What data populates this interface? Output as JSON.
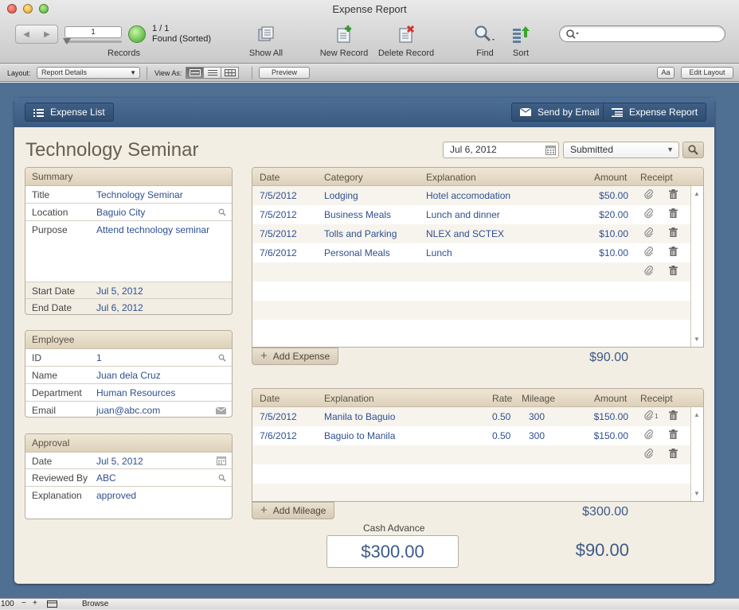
{
  "window": {
    "title": "Expense Report"
  },
  "toolbar": {
    "record_input": "1",
    "found_count": "1 / 1",
    "found_text": "Found (Sorted)",
    "records_label": "Records",
    "show_all": "Show All",
    "new_record": "New Record",
    "delete_record": "Delete Record",
    "find": "Find",
    "sort": "Sort",
    "search_placeholder": ""
  },
  "layout_bar": {
    "layout_label": "Layout:",
    "layout_value": "Report Details",
    "view_as_label": "View As:",
    "preview": "Preview",
    "aa_button": "Aa",
    "edit_layout": "Edit Layout"
  },
  "header": {
    "expense_list": "Expense List",
    "send_by_email": "Send by Email",
    "expense_report": "Expense Report"
  },
  "report": {
    "title": "Technology Seminar",
    "date": "Jul 6, 2012",
    "status": "Submitted"
  },
  "summary": {
    "heading": "Summary",
    "fields": {
      "title_label": "Title",
      "title_value": "Technology Seminar",
      "location_label": "Location",
      "location_value": "Baguio City",
      "purpose_label": "Purpose",
      "purpose_value": "Attend technology seminar",
      "start_label": "Start Date",
      "start_value": "Jul 5, 2012",
      "end_label": "End Date",
      "end_value": "Jul 6, 2012"
    }
  },
  "employee": {
    "heading": "Employee",
    "id_label": "ID",
    "id_value": "1",
    "name_label": "Name",
    "name_value": "Juan dela Cruz",
    "dept_label": "Department",
    "dept_value": "Human Resources",
    "email_label": "Email",
    "email_value": "juan@abc.com"
  },
  "approval": {
    "heading": "Approval",
    "date_label": "Date",
    "date_value": "Jul 5, 2012",
    "reviewed_label": "Reviewed By",
    "reviewed_value": "ABC",
    "explanation_label": "Explanation",
    "explanation_value": "approved"
  },
  "expenses": {
    "columns": {
      "date": "Date",
      "category": "Category",
      "explanation": "Explanation",
      "amount": "Amount",
      "receipt": "Receipt"
    },
    "rows": [
      {
        "date": "7/5/2012",
        "category": "Lodging",
        "explanation": "Hotel accomodation",
        "amount": "$50.00"
      },
      {
        "date": "7/5/2012",
        "category": "Business Meals",
        "explanation": "Lunch and dinner",
        "amount": "$20.00"
      },
      {
        "date": "7/5/2012",
        "category": "Tolls and Parking",
        "explanation": "NLEX and SCTEX",
        "amount": "$10.00"
      },
      {
        "date": "7/6/2012",
        "category": "Personal Meals",
        "explanation": "Lunch",
        "amount": "$10.00"
      }
    ],
    "add_label": "Add Expense",
    "total": "$90.00"
  },
  "mileage": {
    "columns": {
      "date": "Date",
      "explanation": "Explanation",
      "rate": "Rate",
      "mileage": "Mileage",
      "amount": "Amount",
      "receipt": "Receipt"
    },
    "rows": [
      {
        "date": "7/5/2012",
        "explanation": "Manila to Baguio",
        "rate": "0.50",
        "mileage": "300",
        "amount": "$150.00",
        "receipt_count": "1"
      },
      {
        "date": "7/6/2012",
        "explanation": "Baguio to Manila",
        "rate": "0.50",
        "mileage": "300",
        "amount": "$150.00"
      }
    ],
    "add_label": "Add Mileage",
    "total": "$300.00"
  },
  "cash_advance": {
    "label": "Cash Advance",
    "value": "$300.00"
  },
  "grand_total": "$90.00",
  "status_bar": {
    "zoom": "100",
    "mode": "Browse"
  },
  "colors": {
    "accent_blue": "#4f6f93",
    "value_text": "#2f4f8f",
    "panel_bg": "#f3eee4"
  }
}
